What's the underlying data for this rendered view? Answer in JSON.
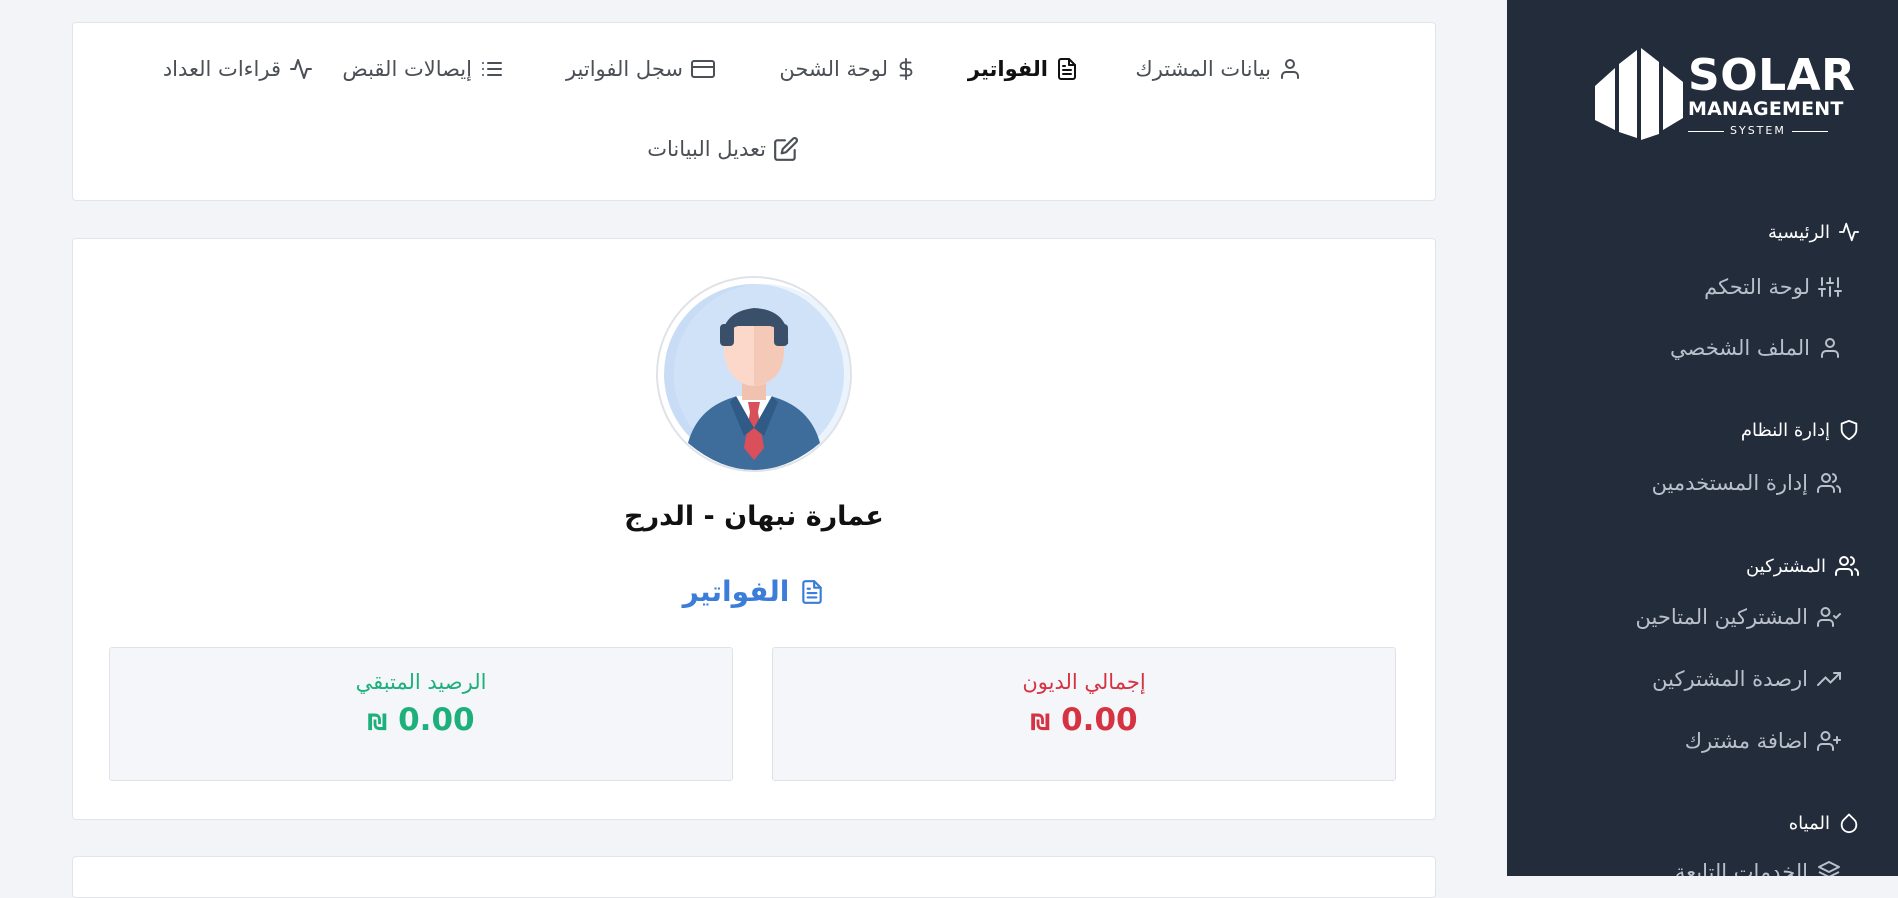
{
  "logo": {
    "line1": "SOLAR",
    "line2": "MANAGEMENT",
    "line3": "SYSTEM"
  },
  "sidebar": {
    "sections": [
      {
        "label": "الرئيسية",
        "icon": "activity-icon"
      },
      {
        "label": "إدارة النظام",
        "icon": "shield-icon"
      },
      {
        "label": "المشتركين",
        "icon": "users-icon"
      },
      {
        "label": "المياه",
        "icon": "droplet-icon"
      }
    ],
    "items": [
      {
        "label": "لوحة التحكم",
        "icon": "sliders-icon"
      },
      {
        "label": "الملف الشخصي",
        "icon": "user-icon"
      },
      {
        "label": "إدارة المستخدمين",
        "icon": "users-icon"
      },
      {
        "label": "المشتركين المتاحين",
        "icon": "user-check-icon"
      },
      {
        "label": "ارصدة المشتركين",
        "icon": "trending-up-icon"
      },
      {
        "label": "اضافة مشترك",
        "icon": "user-plus-icon"
      },
      {
        "label": "الخدمات التابعة",
        "icon": "layers-icon"
      }
    ]
  },
  "tabs": [
    {
      "label": "بيانات المشترك",
      "icon": "user-icon"
    },
    {
      "label": "الفواتير",
      "icon": "file-text-icon",
      "active": true
    },
    {
      "label": "لوحة الشحن",
      "icon": "dollar-sign-icon"
    },
    {
      "label": "سجل الفواتير",
      "icon": "credit-card-icon"
    },
    {
      "label": "إيصالات القبض",
      "icon": "list-icon"
    },
    {
      "label": "قراءات العداد",
      "icon": "activity-icon"
    },
    {
      "label": "تعديل البيانات",
      "icon": "edit-icon"
    }
  ],
  "profile": {
    "name": "عمارة نبهان - الدرج",
    "section_title": "الفواتير",
    "total_debts_label": "إجمالي الديون",
    "total_debts_value": "0.00",
    "remaining_balance_label": "الرصيد المتبقي",
    "remaining_balance_value": "0.00",
    "currency": "₪"
  },
  "colors": {
    "sidebar_bg": "#222c3a",
    "accent": "#3b7dd8",
    "debt": "#d63342",
    "balance": "#1eb07a"
  }
}
